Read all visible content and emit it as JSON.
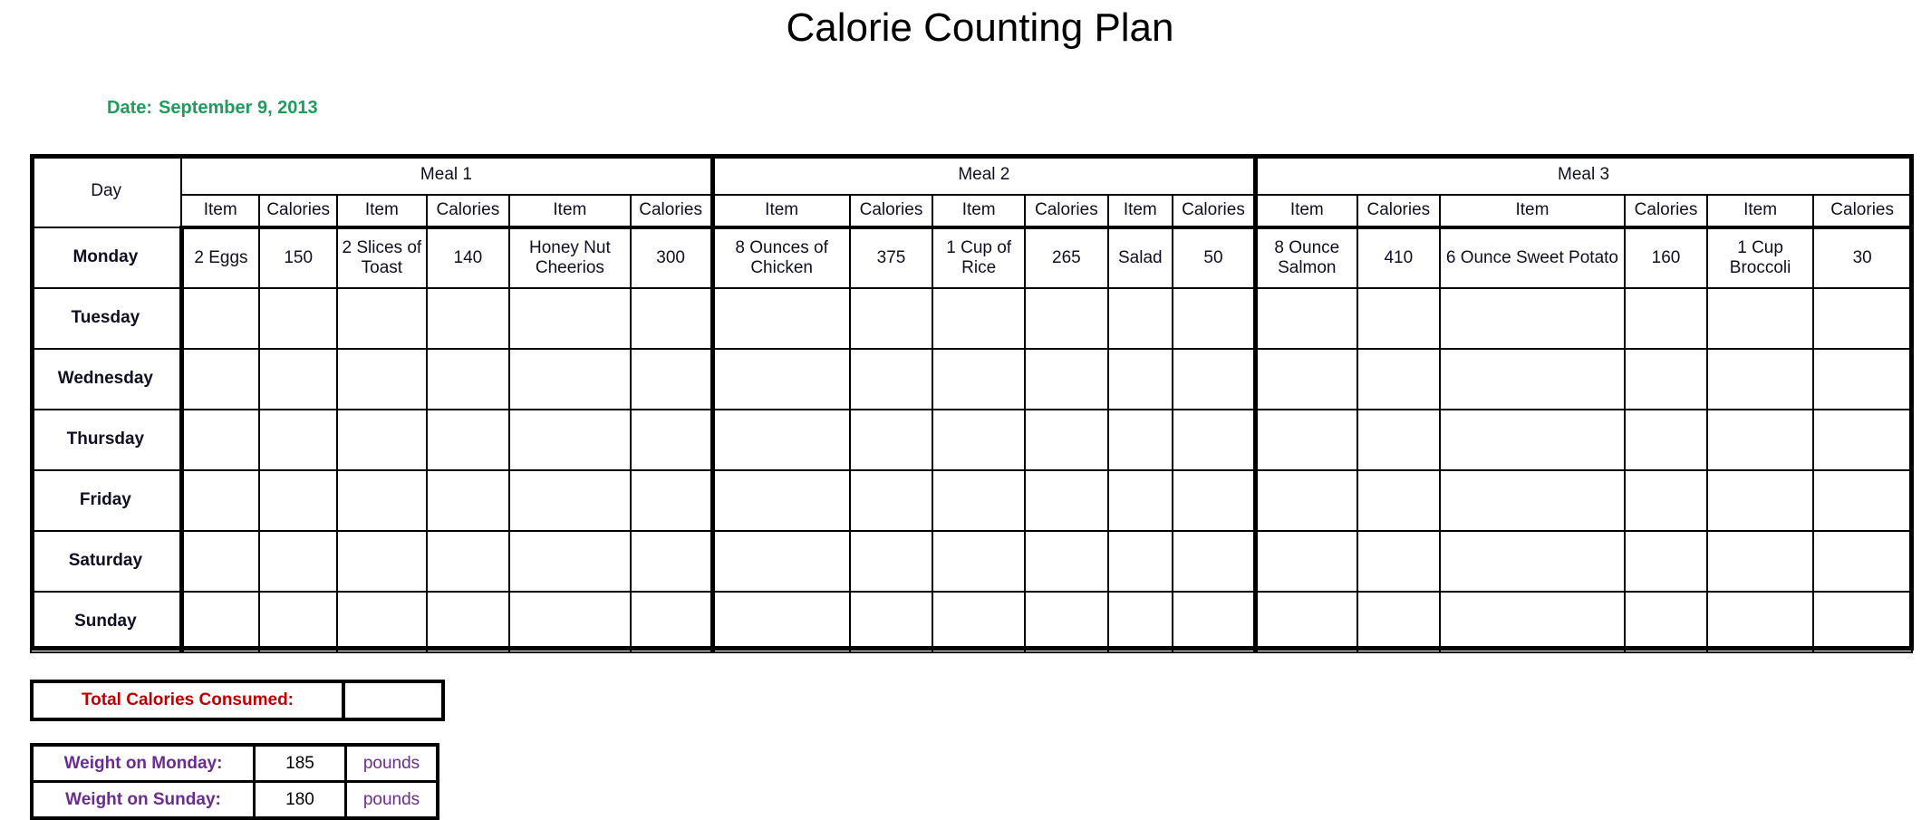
{
  "title": "Calorie Counting Plan",
  "date": {
    "label": "Date:",
    "value": "September 9, 2013"
  },
  "colors": {
    "meal_header_green": "#1FA464",
    "date_green": "#1F9C5C",
    "calories_red": "#C00000",
    "item_navy": "#1F3552",
    "weight_purple": "#6B2C91",
    "grid_black": "#000000"
  },
  "table": {
    "day_header": "Day",
    "meals": [
      {
        "name": "Meal 1"
      },
      {
        "name": "Meal 2"
      },
      {
        "name": "Meal 3"
      }
    ],
    "sub_headers": [
      "Item",
      "Calories",
      "Item",
      "Calories",
      "Item",
      "Calories"
    ],
    "sub_headers_full": [
      "Item",
      "Calories",
      "Item",
      "Calories",
      "Item",
      "Calories",
      "Item",
      "Calories",
      "Item",
      "Calories",
      "Item",
      "Calories",
      "Item",
      "Calories",
      "Item",
      "Calories",
      "Item",
      "Calories"
    ],
    "days": [
      "Monday",
      "Tuesday",
      "Wednesday",
      "Thursday",
      "Friday",
      "Saturday",
      "Sunday"
    ],
    "rows": [
      {
        "day": "Monday",
        "cells": [
          "2 Eggs",
          "150",
          "2 Slices of Toast",
          "140",
          "Honey Nut Cheerios",
          "300",
          "8 Ounces of Chicken",
          "375",
          "1 Cup of Rice",
          "265",
          "Salad",
          "50",
          "8 Ounce Salmon",
          "410",
          "6 Ounce Sweet Potato",
          "160",
          "1 Cup Broccoli",
          "30"
        ]
      },
      {
        "day": "Tuesday",
        "cells": [
          "",
          "",
          "",
          "",
          "",
          "",
          "",
          "",
          "",
          "",
          "",
          "",
          "",
          "",
          "",
          "",
          "",
          ""
        ]
      },
      {
        "day": "Wednesday",
        "cells": [
          "",
          "",
          "",
          "",
          "",
          "",
          "",
          "",
          "",
          "",
          "",
          "",
          "",
          "",
          "",
          "",
          "",
          ""
        ]
      },
      {
        "day": "Thursday",
        "cells": [
          "",
          "",
          "",
          "",
          "",
          "",
          "",
          "",
          "",
          "",
          "",
          "",
          "",
          "",
          "",
          "",
          "",
          ""
        ]
      },
      {
        "day": "Friday",
        "cells": [
          "",
          "",
          "",
          "",
          "",
          "",
          "",
          "",
          "",
          "",
          "",
          "",
          "",
          "",
          "",
          "",
          "",
          ""
        ]
      },
      {
        "day": "Saturday",
        "cells": [
          "",
          "",
          "",
          "",
          "",
          "",
          "",
          "",
          "",
          "",
          "",
          "",
          "",
          "",
          "",
          "",
          "",
          ""
        ]
      },
      {
        "day": "Sunday",
        "cells": [
          "",
          "",
          "",
          "",
          "",
          "",
          "",
          "",
          "",
          "",
          "",
          "",
          "",
          "",
          "",
          "",
          "",
          ""
        ]
      }
    ]
  },
  "totals": {
    "label": "Total Calories Consumed:",
    "value": ""
  },
  "weights": {
    "rows": [
      {
        "label": "Weight on Monday:",
        "value": "185",
        "unit": "pounds"
      },
      {
        "label": "Weight on Sunday:",
        "value": "180",
        "unit": "pounds"
      }
    ]
  }
}
